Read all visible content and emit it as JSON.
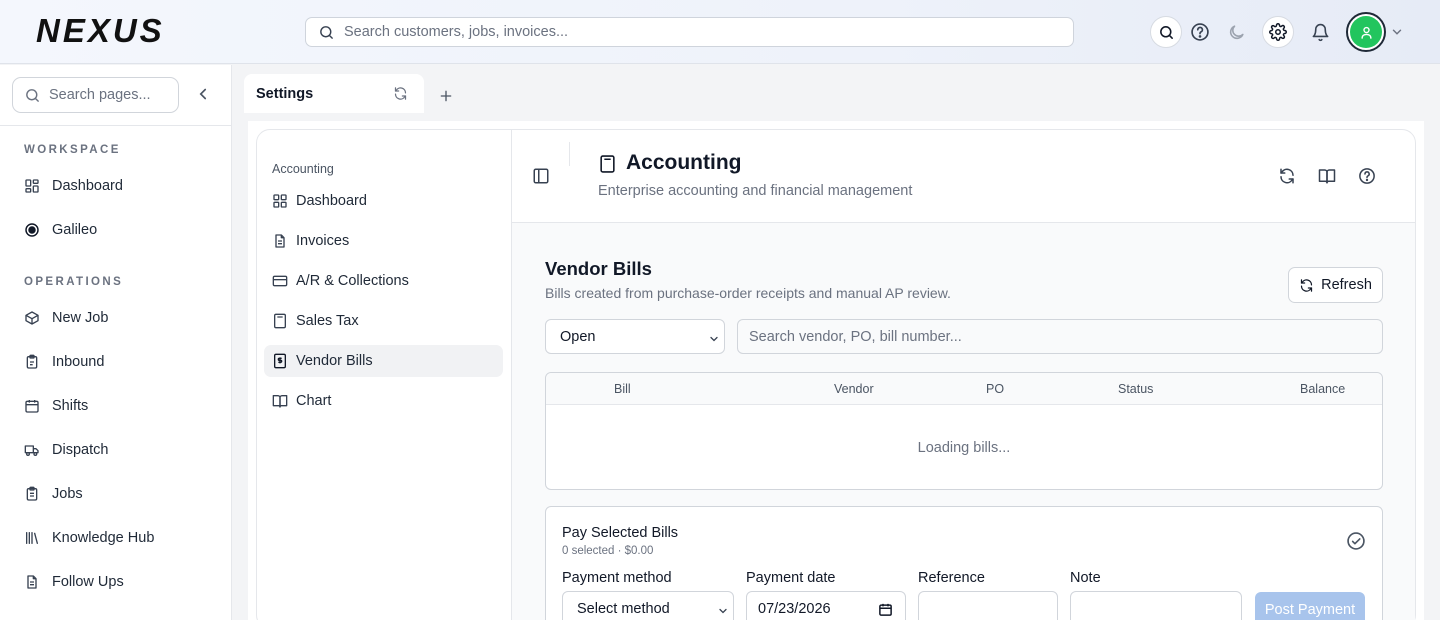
{
  "app": {
    "brand": "NEXUS"
  },
  "header": {
    "search_placeholder": "Search customers, jobs, invoices...",
    "icons": [
      "search-icon",
      "help-icon",
      "moon-icon",
      "gear-icon",
      "bell-icon",
      "user-icon",
      "chevron-down-icon"
    ]
  },
  "sidebar": {
    "search_placeholder": "Search pages...",
    "sections": [
      {
        "label": "WORKSPACE",
        "items": [
          {
            "label": "Dashboard",
            "icon": "dashboard-icon"
          },
          {
            "label": "Galileo",
            "icon": "galileo-icon"
          }
        ]
      },
      {
        "label": "OPERATIONS",
        "items": [
          {
            "label": "New Job",
            "icon": "box-icon"
          },
          {
            "label": "Inbound",
            "icon": "clipboard-icon"
          },
          {
            "label": "Shifts",
            "icon": "calendar-icon"
          },
          {
            "label": "Dispatch",
            "icon": "truck-icon"
          },
          {
            "label": "Jobs",
            "icon": "clipboard-list-icon"
          },
          {
            "label": "Knowledge Hub",
            "icon": "library-icon"
          },
          {
            "label": "Follow Ups",
            "icon": "file-icon"
          }
        ]
      }
    ]
  },
  "tabs": [
    {
      "label": "Settings",
      "active": true
    }
  ],
  "subnav": {
    "title": "Accounting",
    "items": [
      {
        "label": "Dashboard",
        "icon": "dashboard-icon"
      },
      {
        "label": "Invoices",
        "icon": "invoice-icon"
      },
      {
        "label": "A/R & Collections",
        "icon": "credit-card-icon"
      },
      {
        "label": "Sales Tax",
        "icon": "calculator-icon"
      },
      {
        "label": "Vendor Bills",
        "icon": "receipt-icon",
        "active": true
      },
      {
        "label": "Chart",
        "icon": "book-icon"
      }
    ]
  },
  "page": {
    "title": "Accounting",
    "subtitle": "Enterprise accounting and financial management"
  },
  "vendor_bills": {
    "title": "Vendor Bills",
    "subtitle": "Bills created from purchase-order receipts and manual AP review.",
    "refresh_label": "Refresh",
    "status_filter": "Open",
    "search_placeholder": "Search vendor, PO, bill number...",
    "columns": [
      "Bill",
      "Vendor",
      "PO",
      "Status",
      "Balance"
    ],
    "loading_text": "Loading bills..."
  },
  "payment": {
    "title": "Pay Selected Bills",
    "summary": "0 selected · $0.00",
    "method_label": "Payment method",
    "method_value": "Select method",
    "date_label": "Payment date",
    "date_value": "07/23/2026",
    "reference_label": "Reference",
    "note_label": "Note",
    "post_label": "Post Payment"
  },
  "colors": {
    "accent": "#22c55e",
    "post_button": "#a8c4ec",
    "text": "#111827"
  }
}
